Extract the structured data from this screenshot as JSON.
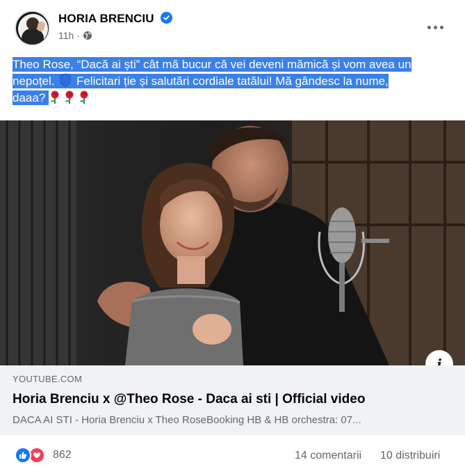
{
  "post": {
    "author": "HORIA BRENCIU",
    "timestamp": "11h",
    "separator": "·",
    "audience_icon": "globe-icon",
    "caption": {
      "line1": "Theo Rose, “Dacă ai ști” cât mă bucur că vei deveni mămică și vom avea un",
      "line2a": "nepoțel.",
      "line2b": "Felicitari ție și salutări cordiale tatălui! Mă gândesc la nume,",
      "line3": "daaa?",
      "emojis": [
        "shield-emoji",
        "rose-emoji",
        "rose-emoji",
        "rose-emoji"
      ]
    },
    "highlight_color": "#3a80e8",
    "link": {
      "domain": "YOUTUBE.COM",
      "title": "Horia Brenciu x @Theo Rose - Daca ai sti | Official video",
      "description": "DACA AI STI - Horia Brenciu x Theo RoseBooking HB & HB orchestra: 07..."
    },
    "reactions": {
      "types": [
        "like-icon",
        "love-icon"
      ],
      "count": "862"
    },
    "comments": "14 comentarii",
    "shares": "10 distribuiri"
  },
  "colors": {
    "brand_blue": "#1877f2",
    "love_red": "#f33e58",
    "secondary_text": "#65676b",
    "link_bg": "#f0f2f5"
  }
}
